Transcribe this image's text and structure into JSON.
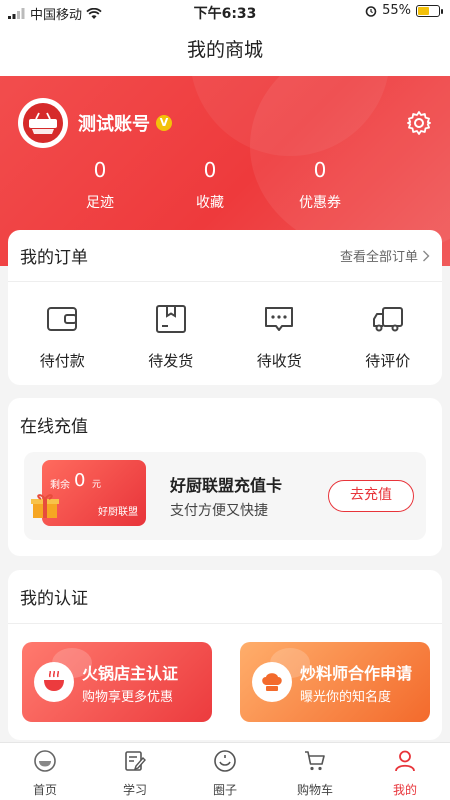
{
  "status_bar": {
    "carrier": "中国移动",
    "time": "下午6:33",
    "battery_text": "55%",
    "battery_level": 0.55
  },
  "nav": {
    "title": "我的商城"
  },
  "profile": {
    "name": "测试账号",
    "verified_badge": "V",
    "logo_text": "好厨联盟",
    "stats": [
      {
        "value": "0",
        "label": "足迹"
      },
      {
        "value": "0",
        "label": "收藏"
      },
      {
        "value": "0",
        "label": "优惠券"
      }
    ]
  },
  "orders": {
    "title": "我的订单",
    "view_all": "查看全部订单",
    "items": [
      {
        "label": "待付款",
        "icon": "wallet-icon"
      },
      {
        "label": "待发货",
        "icon": "box-icon"
      },
      {
        "label": "待收货",
        "icon": "message-icon"
      },
      {
        "label": "待评价",
        "icon": "truck-icon"
      }
    ]
  },
  "recharge": {
    "title": "在线充值",
    "card_remaining_label": "剩余",
    "card_amount": "0",
    "card_unit": "元",
    "card_brand": "好厨联盟",
    "name": "好厨联盟充值卡",
    "subtitle": "支付方便又快捷",
    "button": "去充值"
  },
  "certification": {
    "title": "我的认证",
    "items": [
      {
        "title": "火锅店主认证",
        "subtitle": "购物享更多优惠",
        "icon": "hotpot-icon"
      },
      {
        "title": "炒料师合作申请",
        "subtitle": "曝光你的知名度",
        "icon": "chef-hat-icon"
      }
    ]
  },
  "tabbar": {
    "items": [
      {
        "label": "首页",
        "icon": "home-bowl-icon"
      },
      {
        "label": "学习",
        "icon": "edit-note-icon"
      },
      {
        "label": "圈子",
        "icon": "circle-icon"
      },
      {
        "label": "购物车",
        "icon": "cart-icon"
      },
      {
        "label": "我的",
        "icon": "user-icon",
        "active": true
      }
    ],
    "active_color": "#e8343a"
  },
  "colors": {
    "brand_red": "#ee3a3c",
    "accent_yellow": "#f3c10a"
  }
}
